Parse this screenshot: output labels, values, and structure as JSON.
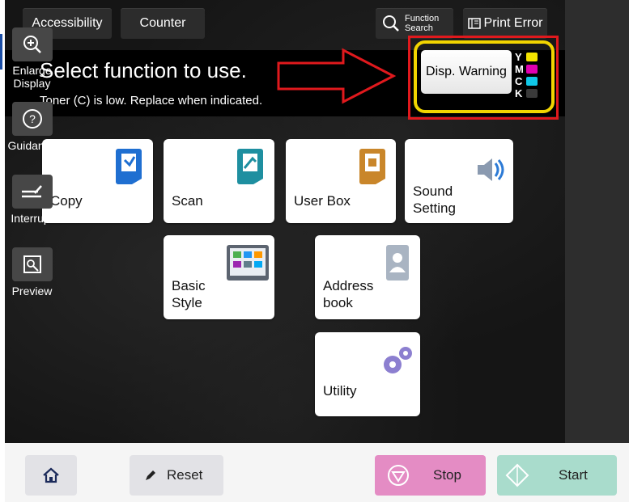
{
  "topbar": {
    "accessibility": "Accessibility",
    "counter": "Counter",
    "function_search_line1": "Function",
    "function_search_line2": "Search",
    "print_error": "Print Error"
  },
  "header": {
    "title": "Select function to use.",
    "subtitle": "Toner (C) is low. Replace when indicated."
  },
  "warning": {
    "button_label": "Disp. Warning",
    "toner": [
      {
        "letter": "Y",
        "color": "#f4e400"
      },
      {
        "letter": "M",
        "color": "#e000b0"
      },
      {
        "letter": "C",
        "color": "#10c8e8"
      },
      {
        "letter": "K",
        "color": "#3a3a3a"
      }
    ]
  },
  "tiles": {
    "copy": "Copy",
    "scan": "Scan",
    "user_box": "User Box",
    "sound_line1": "Sound",
    "sound_line2": "Setting",
    "basic_line1": "Basic",
    "basic_line2": "Style",
    "address_line1": "Address",
    "address_line2": "book",
    "utility": "Utility"
  },
  "sidebar": {
    "enlarge_line1": "Enlarge",
    "enlarge_line2": "Display",
    "guidance": "Guidance",
    "interrupt": "Interrupt",
    "preview": "Preview"
  },
  "bottom": {
    "reset": "Reset",
    "stop": "Stop",
    "start": "Start"
  },
  "colors": {
    "stop_bg": "#e48cc4",
    "start_bg": "#a9dccc",
    "highlight_red": "#e0191d",
    "highlight_yellow": "#f2d500"
  }
}
